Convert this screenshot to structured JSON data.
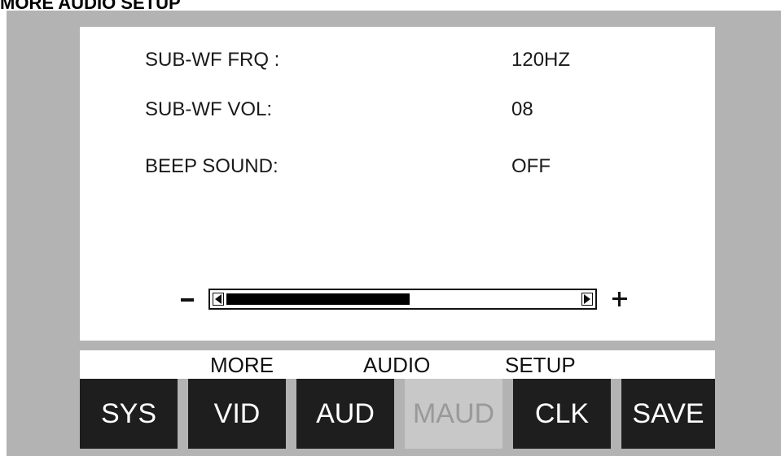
{
  "heading": "MORE AUDIO SETUP",
  "settings": [
    {
      "label": "SUB-WF FRQ :",
      "value": "120HZ"
    },
    {
      "label": "SUB-WF VOL:",
      "value": "08"
    },
    {
      "label": "BEEP SOUND:",
      "value": "OFF"
    }
  ],
  "slider": {
    "minus": "minus-icon",
    "plus": "plus-icon",
    "level_fraction": 0.52
  },
  "title_bar": {
    "words": [
      "MORE",
      "AUDIO",
      "SETUP"
    ]
  },
  "tabs": [
    {
      "label": "SYS",
      "active": false
    },
    {
      "label": "VID",
      "active": false
    },
    {
      "label": "AUD",
      "active": false
    },
    {
      "label": "MAUD",
      "active": true
    },
    {
      "label": "CLK",
      "active": false
    },
    {
      "label": "SAVE",
      "active": false
    }
  ],
  "colors": {
    "background": "#b3b3b3",
    "panel": "#ffffff",
    "tab": "#1e1e1e",
    "tab_active": "#c8c8c8"
  }
}
